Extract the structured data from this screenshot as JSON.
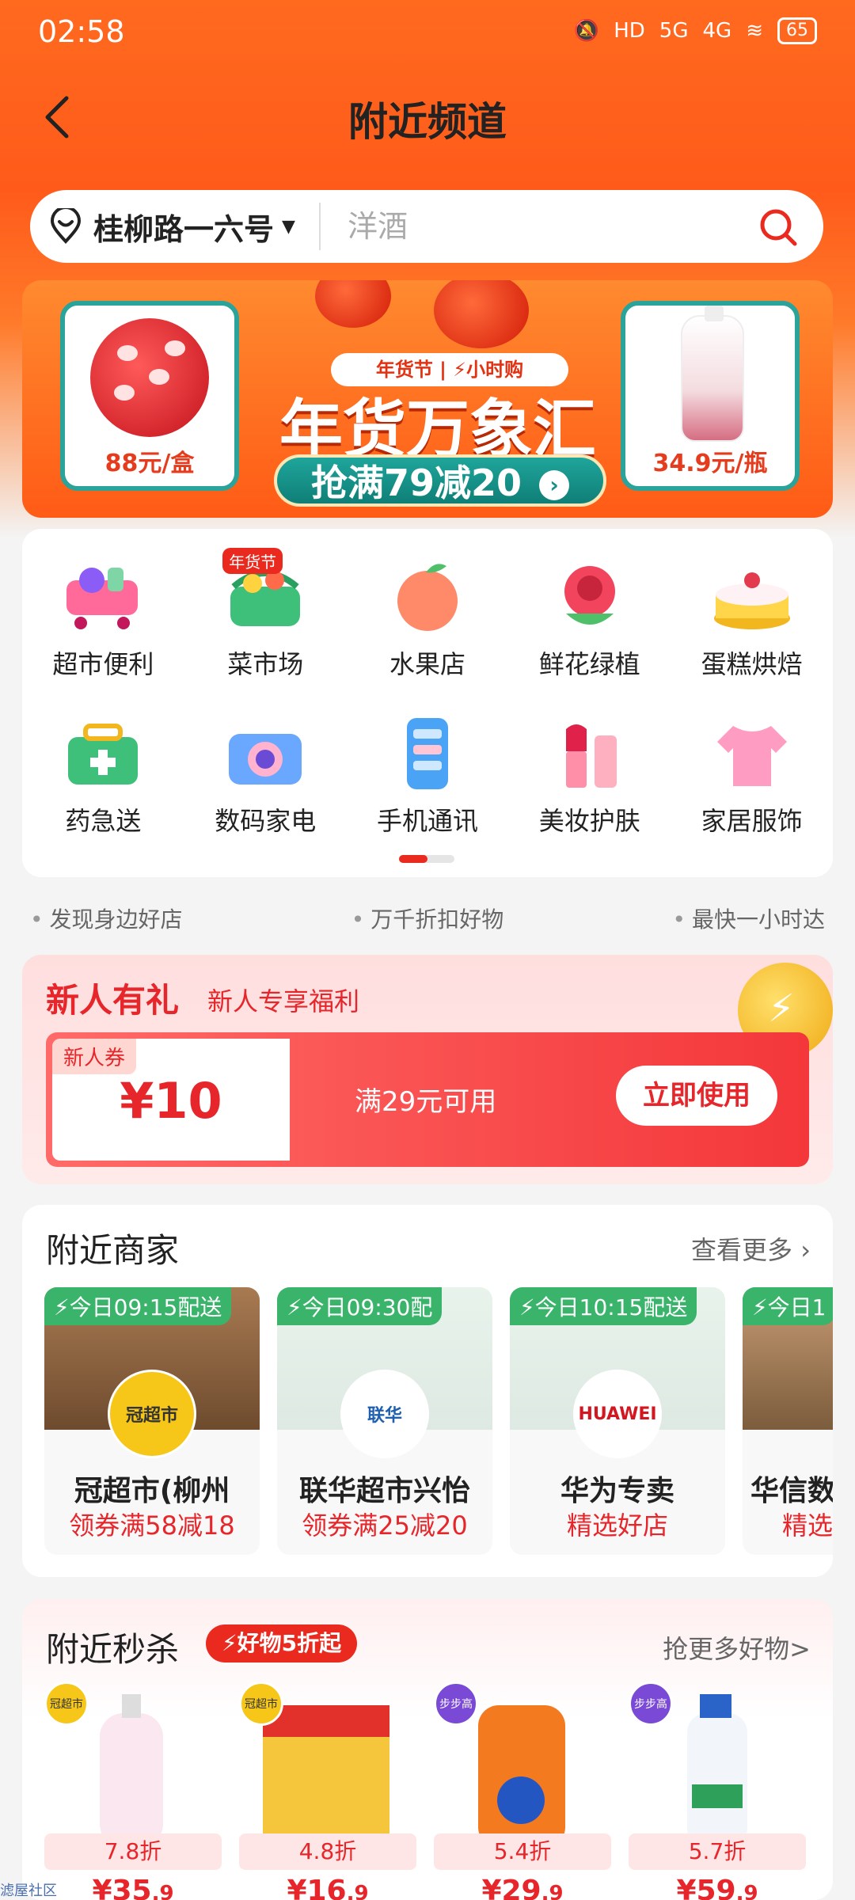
{
  "status": {
    "time": "02:58",
    "battery": "65",
    "signal1": "5G",
    "signal2": "4G"
  },
  "header": {
    "title": "附近频道"
  },
  "search": {
    "location": "桂柳路一六号",
    "placeholder": "洋酒"
  },
  "banner": {
    "tag": "年货节 | ⚡小时购",
    "title": "年货万象汇",
    "cta": "抢满79减20",
    "left_price": "88元/盒",
    "right_price": "34.9元/瓶"
  },
  "categories": [
    {
      "label": "超市便利",
      "icon": "shopping-cart-icon"
    },
    {
      "label": "菜市场",
      "icon": "basket-icon",
      "badge": "年货节"
    },
    {
      "label": "水果店",
      "icon": "peach-icon"
    },
    {
      "label": "鲜花绿植",
      "icon": "rose-icon"
    },
    {
      "label": "蛋糕烘焙",
      "icon": "cake-icon"
    },
    {
      "label": "药急送",
      "icon": "medicine-box-icon"
    },
    {
      "label": "数码家电",
      "icon": "camera-icon"
    },
    {
      "label": "手机通讯",
      "icon": "phone-icon"
    },
    {
      "label": "美妆护肤",
      "icon": "lipstick-icon"
    },
    {
      "label": "家居服饰",
      "icon": "shirt-icon"
    }
  ],
  "features": [
    "发现身边好店",
    "万千折扣好物",
    "最快一小时达"
  ],
  "new_user": {
    "title": "新人有礼",
    "subtitle": "新人专享福利",
    "coupon_tag": "新人券",
    "amount": "¥10",
    "condition": "满29元可用",
    "button": "立即使用"
  },
  "shops": {
    "title": "附近商家",
    "more": "查看更多 ›",
    "items": [
      {
        "badge": "⚡今日09:15配送",
        "name": "冠超市(柳州",
        "promo": "领券满58减18",
        "logo": "冠超市"
      },
      {
        "badge": "⚡今日09:30配",
        "name": "联华超市兴怡",
        "promo": "领券满25减20",
        "logo": "联华"
      },
      {
        "badge": "⚡今日10:15配送",
        "name": "华为专卖",
        "promo": "精选好店",
        "logo": "HUAWEI"
      },
      {
        "badge": "⚡今日1",
        "name": "华信数",
        "promo": "精选",
        "logo": ""
      }
    ]
  },
  "flash": {
    "title": "附近秒杀",
    "tag": "⚡好物5折起",
    "more": "抢更多好物>",
    "items": [
      {
        "discount": "7.8折",
        "price": "¥35",
        "cents": ".9",
        "store": "冠超市"
      },
      {
        "discount": "4.8折",
        "price": "¥16",
        "cents": ".9",
        "store": "冠超市"
      },
      {
        "discount": "5.4折",
        "price": "¥29",
        "cents": ".9",
        "store": "步步高"
      },
      {
        "discount": "5.7折",
        "price": "¥59",
        "cents": ".9",
        "store": "步步高"
      }
    ]
  },
  "footer": {
    "note": "滤屋社区"
  },
  "colors": {
    "brand_orange": "#ff5a1a",
    "accent_red": "#ea2a1e",
    "teal": "#1a8f86",
    "green": "#3ab46b"
  }
}
